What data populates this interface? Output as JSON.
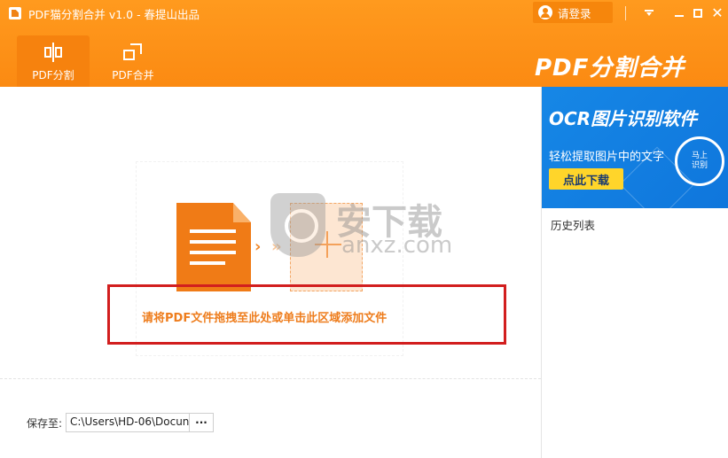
{
  "window": {
    "title": "PDF猫分割合并 v1.0 - 春提山出品",
    "login_label": "请登录"
  },
  "toolbar": {
    "tabs": [
      {
        "label": "PDF分割",
        "active": true
      },
      {
        "label": "PDF合并",
        "active": false
      }
    ],
    "brand_title": "PDF分割合并"
  },
  "main": {
    "drop_hint": "请将PDF文件拖拽至此处或单击此区域添加文件",
    "watermark": {
      "cn": "安下载",
      "en": "anxz.com"
    },
    "save_label": "保存至:",
    "save_path": "C:\\Users\\HD-06\\Docun",
    "browse_label": "···"
  },
  "sidebar": {
    "ad": {
      "title": "OCR图片识别软件",
      "subtitle": "轻松提取图片中的文字",
      "button": "点此下载",
      "badge": "马上识别"
    },
    "history_label": "历史列表"
  },
  "colors": {
    "header_orange": "#fb8a12",
    "accent_orange": "#ee7d1d",
    "highlight_red": "#d21e1e",
    "ad_blue": "#1687e6",
    "ad_button_yellow": "#ffd52a"
  }
}
